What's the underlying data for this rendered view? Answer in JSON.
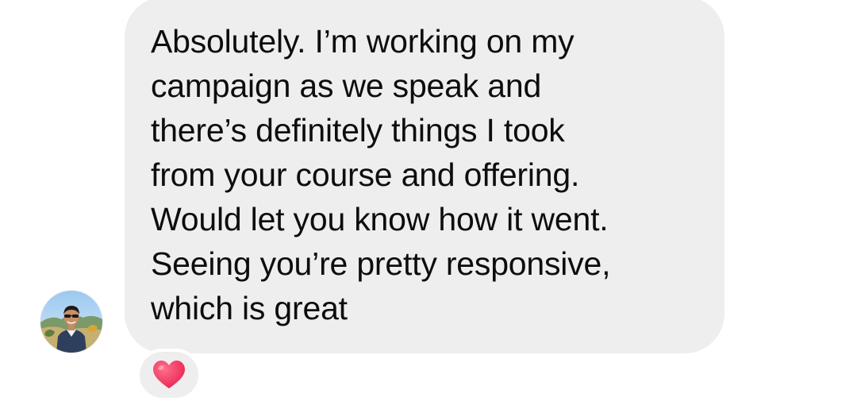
{
  "conversation": {
    "message": {
      "lines": [
        "Absolutely. I’m working on my",
        "campaign as we speak and",
        "there’s definitely things I took",
        "from your course and offering.",
        "Would let you know how it went.",
        "Seeing you’re pretty responsive,",
        "which is great"
      ],
      "bubble_color": "#eeeeef",
      "text_color": "#0d0d0d"
    },
    "sender": {
      "avatar_icon": "profile-photo"
    },
    "reaction": {
      "icon": "red-heart-icon",
      "color": "#f0385f"
    }
  }
}
